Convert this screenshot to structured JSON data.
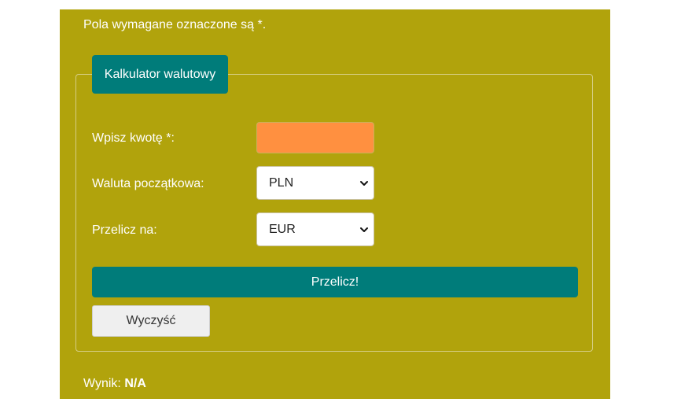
{
  "form": {
    "required_note": "Pola wymagane oznaczone są *.",
    "legend": "Kalkulator walutowy",
    "amount_label": "Wpisz kwotę *:",
    "amount_value": "",
    "from_label": "Waluta początkowa:",
    "from_value": "PLN",
    "to_label": "Przelicz na:",
    "to_value": "EUR",
    "convert_button": "Przelicz!",
    "clear_button": "Wyczyść",
    "result_label": "Wynik:",
    "result_value": "N/A"
  },
  "icons": {
    "select_chevron": "chevron-down-icon"
  },
  "colors": {
    "panel_bg": "#b1a30c",
    "accent": "#007c7a",
    "amount_input_bg": "#ff9040",
    "clear_button_bg": "#efefef"
  }
}
